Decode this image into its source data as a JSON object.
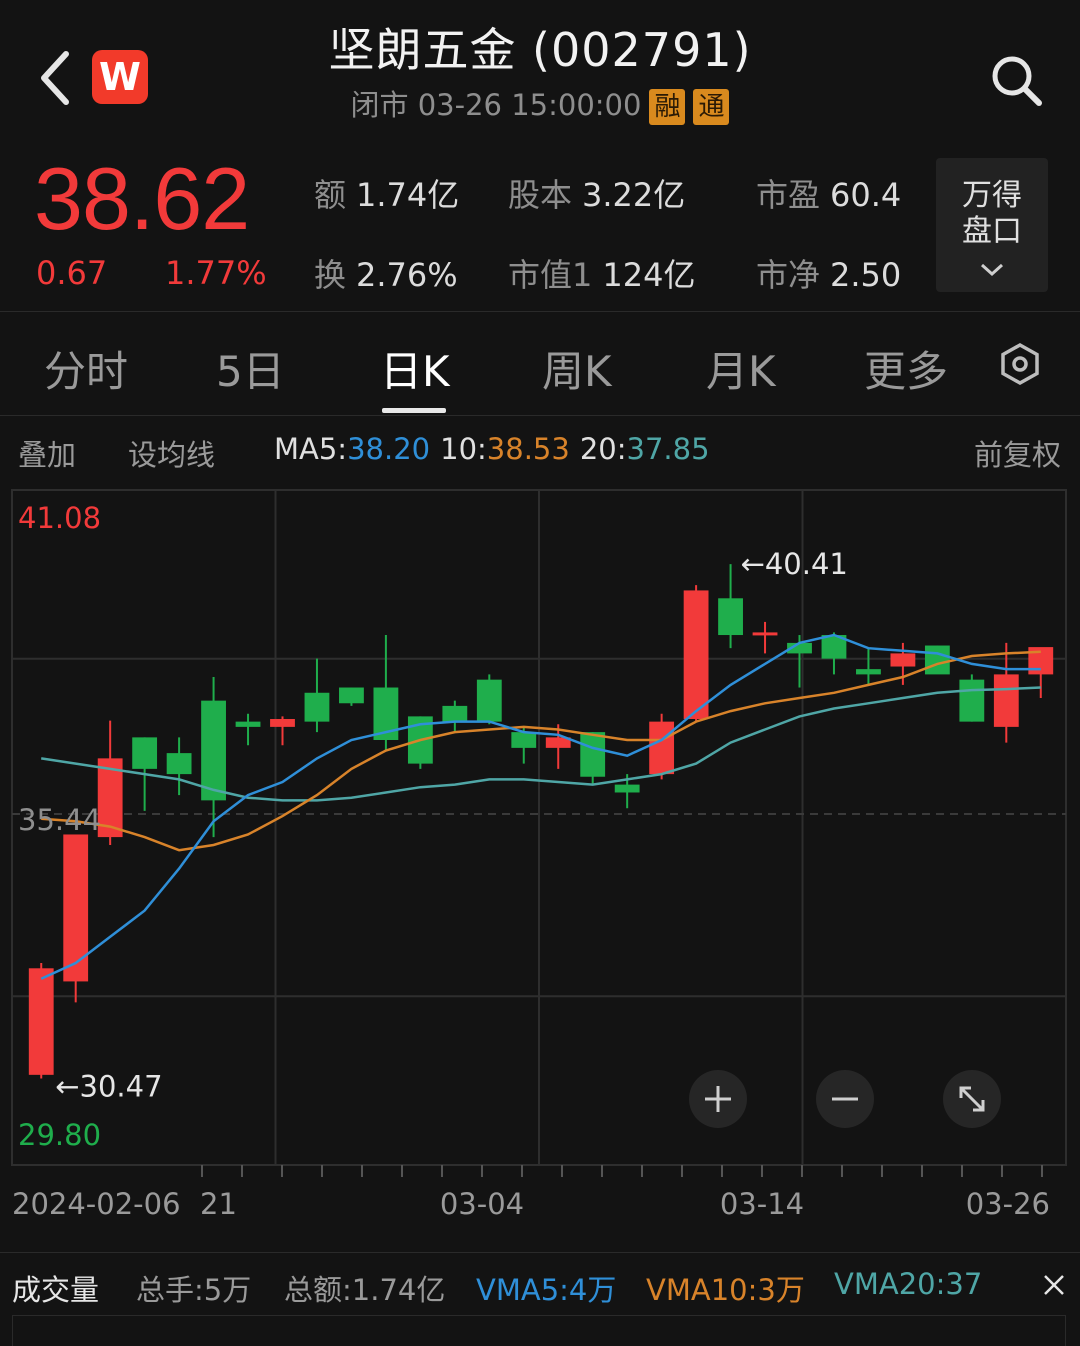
{
  "header": {
    "title": "坚朗五金 (002791)",
    "status": "闭市 03-26 15:00:00",
    "badge1": "融",
    "badge2": "通",
    "logo_letter": "W"
  },
  "quote": {
    "price": "38.62",
    "change": "0.67",
    "change_pct": "1.77%",
    "stats": [
      {
        "label": "额",
        "value": "1.74亿"
      },
      {
        "label": "股本",
        "value": "3.22亿"
      },
      {
        "label": "市盈",
        "value": "60.4"
      },
      {
        "label": "换",
        "value": "2.76%"
      },
      {
        "label": "市值1",
        "value": "124亿"
      },
      {
        "label": "市净",
        "value": "2.50"
      }
    ],
    "pankou_line1": "万得",
    "pankou_line2": "盘口"
  },
  "tabs": [
    {
      "label": "分时",
      "active": false
    },
    {
      "label": "5日",
      "active": false
    },
    {
      "label": "日K",
      "active": true
    },
    {
      "label": "周K",
      "active": false
    },
    {
      "label": "月K",
      "active": false
    },
    {
      "label": "更多",
      "active": false
    }
  ],
  "ma_bar": {
    "overlay": "叠加",
    "set_ma": "设均线",
    "ma5_label": "MA5:",
    "ma5_value": "38.20",
    "ma10_label": "10:",
    "ma10_value": "38.53",
    "ma20_label": "20:",
    "ma20_value": "37.85",
    "adjust": "前复权"
  },
  "volume_bar": {
    "title": "成交量",
    "hands": "总手:5万",
    "amount": "总额:1.74亿",
    "vma5": "VMA5:4万",
    "vma10": "VMA10:3万",
    "vma20": "VMA20:37"
  },
  "colors": {
    "up": "#f23a3a",
    "down": "#1fae4c",
    "ma5": "#2f8fd8",
    "ma10": "#d8832a",
    "ma20": "#4fa6a6",
    "price_high": "#f23a3a",
    "price_low": "#1fae4c"
  },
  "chart_data": {
    "type": "candlestick",
    "y_range": [
      29.8,
      41.08
    ],
    "y_labels": [
      "41.08",
      "35.44",
      "29.80"
    ],
    "high_marker": "40.41",
    "low_marker": "30.47",
    "x_labels": [
      "2024-02-06",
      "21",
      "03-04",
      "03-14",
      "03-26"
    ],
    "candles": [
      {
        "o": 30.47,
        "h": 32.6,
        "l": 30.4,
        "c": 32.5
      },
      {
        "o": 32.25,
        "h": 34.85,
        "l": 31.85,
        "c": 35.05
      },
      {
        "o": 35.0,
        "h": 37.22,
        "l": 34.85,
        "c": 36.5
      },
      {
        "o": 36.9,
        "h": 36.9,
        "l": 35.5,
        "c": 36.3
      },
      {
        "o": 36.6,
        "h": 36.9,
        "l": 35.8,
        "c": 36.2
      },
      {
        "o": 37.6,
        "h": 38.05,
        "l": 35.0,
        "c": 35.7
      },
      {
        "o": 37.2,
        "h": 37.35,
        "l": 36.75,
        "c": 37.1
      },
      {
        "o": 37.1,
        "h": 37.3,
        "l": 36.75,
        "c": 37.25
      },
      {
        "o": 37.75,
        "h": 38.4,
        "l": 37.0,
        "c": 37.2
      },
      {
        "o": 37.85,
        "h": 37.85,
        "l": 37.5,
        "c": 37.55
      },
      {
        "o": 37.85,
        "h": 38.85,
        "l": 36.65,
        "c": 36.85
      },
      {
        "o": 37.3,
        "h": 37.3,
        "l": 36.3,
        "c": 36.4
      },
      {
        "o": 37.5,
        "h": 37.6,
        "l": 37.0,
        "c": 37.2
      },
      {
        "o": 38.0,
        "h": 38.1,
        "l": 37.15,
        "c": 37.2
      },
      {
        "o": 37.0,
        "h": 37.1,
        "l": 36.4,
        "c": 36.7
      },
      {
        "o": 36.7,
        "h": 37.15,
        "l": 36.3,
        "c": 36.9
      },
      {
        "o": 37.0,
        "h": 37.0,
        "l": 36.0,
        "c": 36.15
      },
      {
        "o": 36.0,
        "h": 36.2,
        "l": 35.55,
        "c": 35.85
      },
      {
        "o": 36.2,
        "h": 37.35,
        "l": 36.1,
        "c": 37.2
      },
      {
        "o": 37.25,
        "h": 39.8,
        "l": 37.2,
        "c": 39.7
      },
      {
        "o": 39.55,
        "h": 40.2,
        "l": 38.6,
        "c": 38.85
      },
      {
        "o": 38.85,
        "h": 39.1,
        "l": 38.5,
        "c": 38.9
      },
      {
        "o": 38.7,
        "h": 38.85,
        "l": 37.85,
        "c": 38.5
      },
      {
        "o": 38.85,
        "h": 38.9,
        "l": 38.1,
        "c": 38.4
      },
      {
        "o": 38.2,
        "h": 38.6,
        "l": 37.9,
        "c": 38.1
      },
      {
        "o": 38.25,
        "h": 38.7,
        "l": 37.9,
        "c": 38.5
      },
      {
        "o": 38.65,
        "h": 38.65,
        "l": 38.3,
        "c": 38.1
      },
      {
        "o": 38.0,
        "h": 38.1,
        "l": 37.2,
        "c": 37.2
      },
      {
        "o": 37.1,
        "h": 38.7,
        "l": 36.8,
        "c": 38.1
      },
      {
        "o": 38.1,
        "h": 38.5,
        "l": 37.65,
        "c": 38.62
      }
    ],
    "ma5": [
      32.3,
      32.6,
      33.1,
      33.6,
      34.4,
      35.3,
      35.8,
      36.05,
      36.5,
      36.85,
      37.0,
      37.15,
      37.2,
      37.2,
      37.0,
      36.95,
      36.7,
      36.55,
      36.85,
      37.4,
      37.9,
      38.3,
      38.7,
      38.85,
      38.6,
      38.55,
      38.5,
      38.3,
      38.2,
      38.2
    ],
    "ma10": [
      35.35,
      35.3,
      35.2,
      35.0,
      34.75,
      34.85,
      35.05,
      35.4,
      35.8,
      36.3,
      36.65,
      36.85,
      37.0,
      37.05,
      37.1,
      37.05,
      36.95,
      36.85,
      36.85,
      37.2,
      37.4,
      37.55,
      37.65,
      37.75,
      37.9,
      38.05,
      38.3,
      38.45,
      38.5,
      38.53
    ],
    "ma20": [
      36.5,
      36.4,
      36.3,
      36.2,
      36.1,
      35.9,
      35.75,
      35.7,
      35.7,
      35.75,
      35.85,
      35.95,
      36.0,
      36.1,
      36.1,
      36.05,
      36.0,
      36.1,
      36.2,
      36.4,
      36.8,
      37.05,
      37.3,
      37.45,
      37.55,
      37.65,
      37.75,
      37.8,
      37.82,
      37.85
    ]
  }
}
